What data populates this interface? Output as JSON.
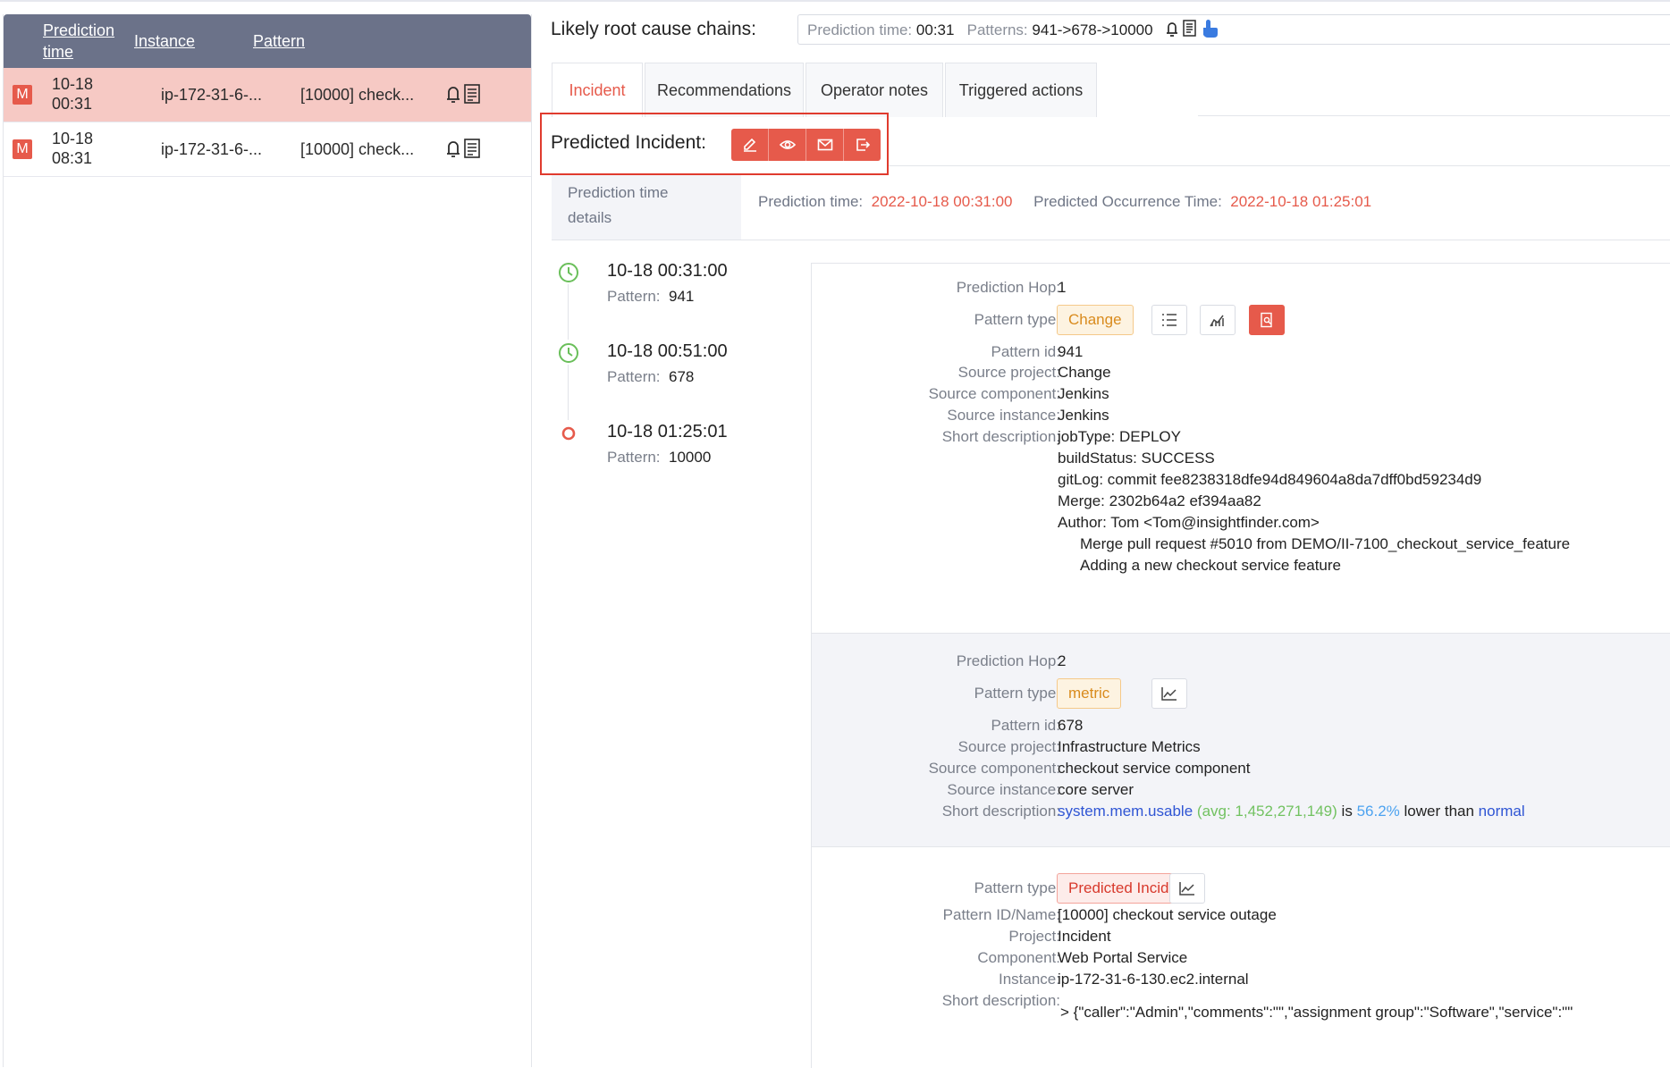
{
  "sidebar": {
    "headers": {
      "prediction_time": "Prediction time",
      "instance": "Instance",
      "pattern": "Pattern"
    },
    "rows": [
      {
        "badge": "M",
        "time_date": "10-18",
        "time_clock": "00:31",
        "instance": "ip-172-31-6-...",
        "pattern": "[10000] check..."
      },
      {
        "badge": "M",
        "time_date": "10-18",
        "time_clock": "08:31",
        "instance": "ip-172-31-6-...",
        "pattern": "[10000] check..."
      }
    ]
  },
  "root_cause": {
    "title": "Likely root cause chains:",
    "box": {
      "pt_label": "Prediction time:",
      "pt_value": "00:31",
      "patterns_label": "Patterns:",
      "patterns_value": "941->678->10000"
    }
  },
  "tabs": [
    "Incident",
    "Recommendations",
    "Operator notes",
    "Triggered actions"
  ],
  "predicted_incident": {
    "label": "Predicted Incident:",
    "buttons": [
      "edit-icon",
      "eye-icon",
      "mail-icon",
      "export-icon"
    ]
  },
  "prediction_details": {
    "side_label_1": "Prediction time",
    "side_label_2": "details",
    "pt_label": "Prediction time:",
    "pt_value": "2022-10-18 00:31:00",
    "occ_label": "Predicted Occurrence Time:",
    "occ_value": "2022-10-18 01:25:01"
  },
  "timeline": [
    {
      "time": "10-18 00:31:00",
      "pattern_label": "Pattern:",
      "pattern": "941",
      "kind": "clock"
    },
    {
      "time": "10-18 00:51:00",
      "pattern_label": "Pattern:",
      "pattern": "678",
      "kind": "clock"
    },
    {
      "time": "10-18 01:25:01",
      "pattern_label": "Pattern:",
      "pattern": "10000",
      "kind": "incident"
    }
  ],
  "hop1": {
    "hop_label": "Prediction Hop:",
    "hop": "1",
    "type_label": "Pattern type:",
    "type": "Change",
    "id_label": "Pattern id:",
    "id": "941",
    "proj_label": "Source project:",
    "proj": "Change",
    "comp_label": "Source component:",
    "comp": "Jenkins",
    "inst_label": "Source instance:",
    "inst": "Jenkins",
    "desc_label": "Short description:",
    "desc_lines": [
      "jobType: DEPLOY",
      "buildStatus: SUCCESS",
      "gitLog: commit fee8238318dfe94d849604a8da7dff0bd59234d9",
      "Merge: 2302b64a2 ef394aa82",
      "Author: Tom <Tom@insightfinder.com>",
      "Merge pull request #5010 from DEMO/II-7100_checkout_service_feature",
      "Adding a new checkout service feature"
    ]
  },
  "hop2": {
    "hop_label": "Prediction Hop:",
    "hop": "2",
    "type_label": "Pattern type:",
    "type": "metric",
    "id_label": "Pattern id:",
    "id": "678",
    "proj_label": "Source project:",
    "proj": "Infrastructure Metrics",
    "comp_label": "Source component:",
    "comp": "checkout service component",
    "inst_label": "Source instance:",
    "inst": "core server",
    "desc_label": "Short description:",
    "desc_metric": "system.mem.usable",
    "desc_avg": "(avg: 1,452,271,149)",
    "desc_is": "is",
    "desc_pct": "56.2%",
    "desc_lower": "lower than",
    "desc_normal": "normal"
  },
  "incident": {
    "type_label": "Pattern type:",
    "type": "Predicted Incident",
    "idname_label": "Pattern ID/Name:",
    "idname": "[10000] checkout service outage",
    "proj_label": "Project:",
    "proj": "Incident",
    "comp_label": "Component:",
    "comp": "Web Portal Service",
    "inst_label": "Instance:",
    "inst": "ip-172-31-6-130.ec2.internal",
    "desc_label": "Short description:",
    "desc": "> {\"caller\":\"Admin\",\"comments\":\"\",\"assignment group\":\"Software\",\"service\":\"\""
  },
  "colors": {
    "accent": "#e65a4b",
    "header": "#6b7289",
    "selected_row": "#f6c9c4"
  }
}
